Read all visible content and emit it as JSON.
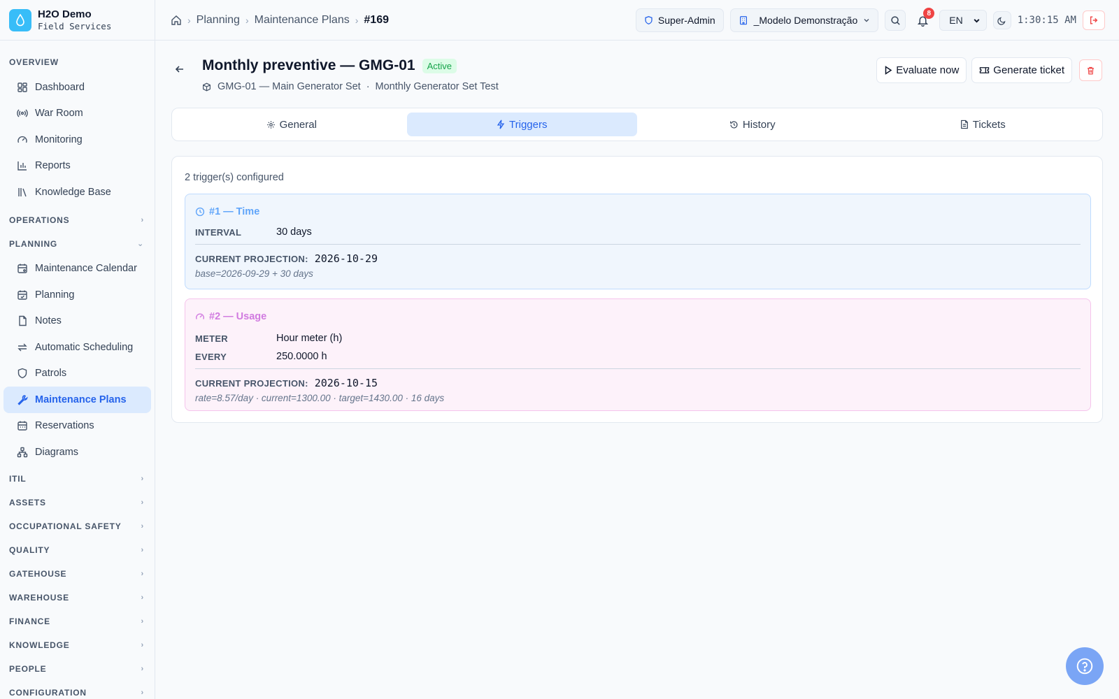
{
  "brand": {
    "name": "H2O Demo",
    "subtitle": "Field Services"
  },
  "sidebar": {
    "overview_label": "OVERVIEW",
    "overview_items": [
      {
        "label": "Dashboard",
        "icon": "grid-icon"
      },
      {
        "label": "War Room",
        "icon": "broadcast-icon"
      },
      {
        "label": "Monitoring",
        "icon": "gauge-icon"
      },
      {
        "label": "Reports",
        "icon": "bar-chart-icon"
      },
      {
        "label": "Knowledge Base",
        "icon": "library-icon"
      }
    ],
    "operations_label": "OPERATIONS",
    "planning_label": "PLANNING",
    "planning_items": [
      {
        "label": "Maintenance Calendar",
        "icon": "calendar-icon"
      },
      {
        "label": "Planning",
        "icon": "calendar-check-icon"
      },
      {
        "label": "Notes",
        "icon": "file-icon"
      },
      {
        "label": "Automatic Scheduling",
        "icon": "repeat-icon"
      },
      {
        "label": "Patrols",
        "icon": "shield-icon"
      },
      {
        "label": "Maintenance Plans",
        "icon": "wrench-icon",
        "active": true
      },
      {
        "label": "Reservations",
        "icon": "calendar-icon"
      },
      {
        "label": "Diagrams",
        "icon": "network-icon"
      }
    ],
    "sections": [
      "ITIL",
      "ASSETS",
      "OCCUPATIONAL SAFETY",
      "QUALITY",
      "GATEHOUSE",
      "WAREHOUSE",
      "FINANCE",
      "KNOWLEDGE",
      "PEOPLE",
      "CONFIGURATION"
    ]
  },
  "header": {
    "breadcrumb": [
      "Planning",
      "Maintenance Plans",
      "#169"
    ],
    "role": "Super-Admin",
    "tenant": "_Modelo Demonstração",
    "notifications": "8",
    "language": "EN",
    "time": "1:30:15 AM"
  },
  "page": {
    "title": "Monthly preventive — GMG-01",
    "status": "Active",
    "asset": "GMG-01 — Main Generator Set",
    "separator": "·",
    "plan": "Monthly Generator Set Test",
    "evaluate_label": "Evaluate now",
    "generate_label": "Generate ticket"
  },
  "tabs": [
    {
      "label": "General",
      "icon": "gear-icon"
    },
    {
      "label": "Triggers",
      "icon": "lightning-icon",
      "active": true
    },
    {
      "label": "History",
      "icon": "history-icon"
    },
    {
      "label": "Tickets",
      "icon": "document-icon"
    }
  ],
  "triggers": {
    "count_text": "2 trigger(s) configured",
    "time": {
      "title": "#1 — Time",
      "interval_label": "INTERVAL",
      "interval_value": "30 days",
      "projection_label": "CURRENT PROJECTION:",
      "projection_value": "2026-10-29",
      "note": "base=2026-09-29 + 30 days"
    },
    "usage": {
      "title": "#2 — Usage",
      "meter_label": "METER",
      "meter_value": "Hour meter (h)",
      "every_label": "EVERY",
      "every_value": "250.0000 h",
      "projection_label": "CURRENT PROJECTION:",
      "projection_value": "2026-10-15",
      "note": "rate=8.57/day · current=1300.00 · target=1430.00 · 16 days"
    }
  },
  "colors": {
    "accent": "#2563eb",
    "time": "#60a5fa",
    "usage": "#d17be0",
    "active": "#16a34a",
    "danger": "#ef4444"
  }
}
